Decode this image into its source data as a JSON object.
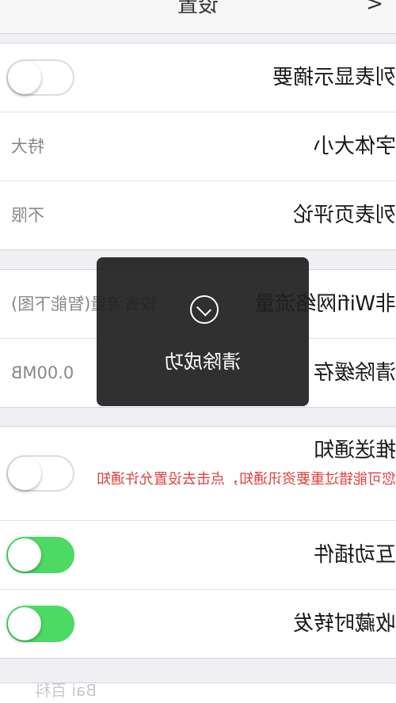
{
  "header": {
    "title": "设置",
    "back": "<"
  },
  "rows": {
    "list_summary": {
      "label": "列表显示摘要",
      "toggle": "off"
    },
    "font_size": {
      "label": "字体大小",
      "value": "特大"
    },
    "list_comments": {
      "label": "列表页评论",
      "value": "不限"
    },
    "non_wifi": {
      "label": "非Wifi网络流量",
      "value": "较省流量(智能下图)"
    },
    "clear_cache": {
      "label": "清除缓存",
      "value": "0.00MB"
    },
    "push": {
      "label": "推送通知",
      "warning": "您可能错过重要资讯通知，点击去设置允许通知",
      "toggle": "off"
    },
    "interactive_plugin": {
      "label": "互动插件",
      "toggle": "on"
    },
    "fav_forward": {
      "label": "收藏时转发",
      "toggle": "on"
    }
  },
  "toast": {
    "text": "清除成功",
    "icon": "check-circle-icon"
  },
  "watermark": "Bai 百科",
  "colors": {
    "toggle_on": "#4cd964",
    "warning": "#e04040",
    "toast_bg": "#1e1e1e"
  }
}
